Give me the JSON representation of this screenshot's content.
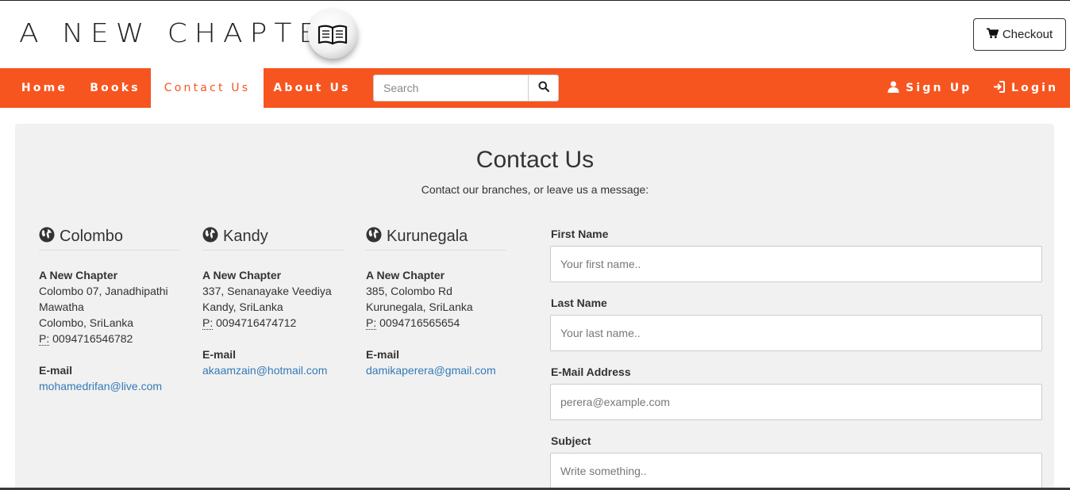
{
  "header": {
    "logo_text": "A NEW CHAPTER",
    "logo_icon": "open-book-icon",
    "checkout_label": "Checkout",
    "checkout_icon": "cart-icon"
  },
  "nav": {
    "items": [
      {
        "label": "Home",
        "active": false
      },
      {
        "label": "Books",
        "active": false
      },
      {
        "label": "Contact Us",
        "active": true
      },
      {
        "label": "About Us",
        "active": false
      }
    ],
    "search_placeholder": "Search",
    "search_icon": "search-icon",
    "signup_label": "Sign Up",
    "signup_icon": "user-icon",
    "login_label": "Login",
    "login_icon": "login-icon",
    "accent_color": "#f75520"
  },
  "main": {
    "title": "Contact Us",
    "subtitle": "Contact our branches, or leave us a message:"
  },
  "branches": [
    {
      "name": "Colombo",
      "company": "A New Chapter",
      "address_lines": [
        "Colombo 07, Janadhipathi Mawatha",
        "Colombo, SriLanka"
      ],
      "phone_label": "P:",
      "phone": "0094716546782",
      "email_label": "E-mail",
      "email": "mohamedrifan@live.com"
    },
    {
      "name": "Kandy",
      "company": "A New Chapter",
      "address_lines": [
        "337, Senanayake Veediya",
        "Kandy, SriLanka"
      ],
      "phone_label": "P:",
      "phone": "0094716474712",
      "email_label": "E-mail",
      "email": "akaamzain@hotmail.com"
    },
    {
      "name": "Kurunegala",
      "company": "A New Chapter",
      "address_lines": [
        "385, Colombo Rd",
        "Kurunegala, SriLanka"
      ],
      "phone_label": "P:",
      "phone": "0094716565654",
      "email_label": "E-mail",
      "email": "damikaperera@gmail.com"
    }
  ],
  "form": {
    "first_name_label": "First Name",
    "first_name_placeholder": "Your first name..",
    "last_name_label": "Last Name",
    "last_name_placeholder": "Your last name..",
    "email_label": "E-Mail Address",
    "email_placeholder": "perera@example.com",
    "subject_label": "Subject",
    "subject_placeholder": "Write something.."
  }
}
